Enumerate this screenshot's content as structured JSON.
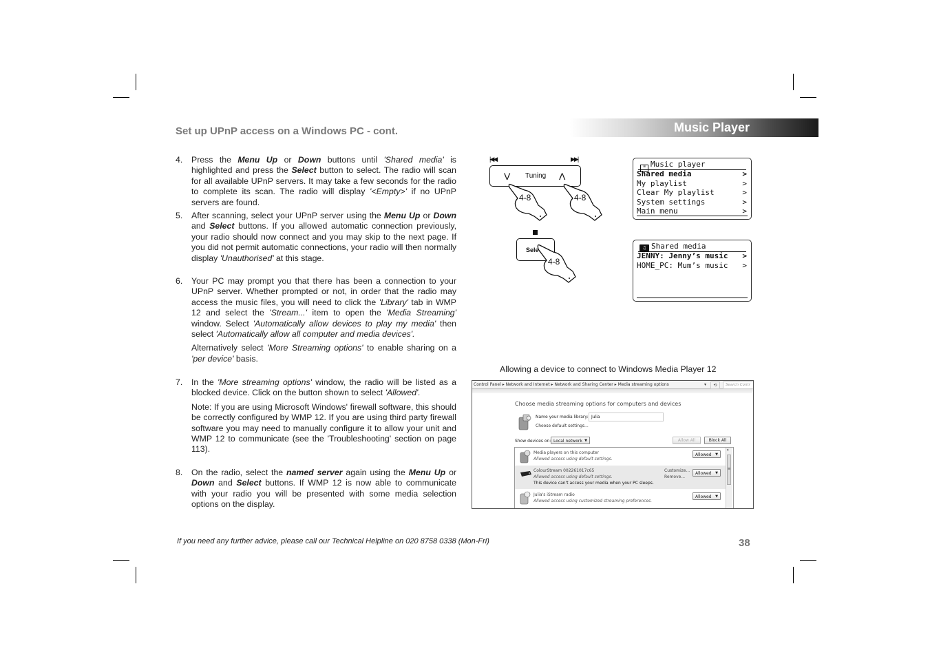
{
  "page": {
    "section_title": "Set up UPnP access on a Windows PC - cont.",
    "header_banner": "Music Player",
    "page_number": "38",
    "footer_note": "If you need any further advice, please call our Technical Helpline on 020 8758 0338 (Mon-Fri)",
    "colors": {
      "section_title": "#7a7a7a",
      "banner_text": "#ffffff",
      "banner_dark": "#1a1a1a",
      "page_number": "#777777"
    }
  },
  "steps": [
    {
      "number": "4.",
      "paragraphs": [
        [
          {
            "t": "Press the ",
            "s": ""
          },
          {
            "t": "Menu Up",
            "s": "bi"
          },
          {
            "t": " or ",
            "s": ""
          },
          {
            "t": "Down",
            "s": "bi"
          },
          {
            "t": " buttons until ",
            "s": ""
          },
          {
            "t": "'Shared media'",
            "s": "i"
          },
          {
            "t": " is highlighted and press the ",
            "s": ""
          },
          {
            "t": "Select",
            "s": "bi"
          },
          {
            "t": " button to select. The radio will scan for all available UPnP servers. It may take a few seconds for the radio to complete its scan. The radio will display ",
            "s": ""
          },
          {
            "t": "'<Empty>'",
            "s": "i"
          },
          {
            "t": " if no UPnP servers are found.",
            "s": ""
          }
        ]
      ]
    },
    {
      "number": "5.",
      "paragraphs": [
        [
          {
            "t": "After scanning, select your UPnP server using the ",
            "s": ""
          },
          {
            "t": "Menu Up",
            "s": "bi"
          },
          {
            "t": " or ",
            "s": ""
          },
          {
            "t": "Down",
            "s": "bi"
          },
          {
            "t": " and ",
            "s": ""
          },
          {
            "t": "Select",
            "s": "bi"
          },
          {
            "t": " buttons. If you allowed automatic connection previously, your radio should now connect and you may skip to the next page. If you did not permit automatic connections, your radio will then normally display ",
            "s": ""
          },
          {
            "t": "'Unauthorised'",
            "s": "i"
          },
          {
            "t": " at this stage.",
            "s": ""
          }
        ]
      ]
    },
    {
      "number": "6.",
      "paragraphs": [
        [
          {
            "t": "Your PC may prompt you that there has been a connection to your UPnP server. Whether prompted or not, in order that the radio may access the music files, you will need to click the ",
            "s": ""
          },
          {
            "t": "'Library'",
            "s": "i"
          },
          {
            "t": " tab in WMP 12 and select the ",
            "s": ""
          },
          {
            "t": "'Stream...'",
            "s": "i"
          },
          {
            "t": " item to open the ",
            "s": ""
          },
          {
            "t": "'Media Streaming'",
            "s": "i"
          },
          {
            "t": " window. Select ",
            "s": ""
          },
          {
            "t": "'Automatically allow devices  to play my media'",
            "s": "i"
          },
          {
            "t": " then select ",
            "s": ""
          },
          {
            "t": "'Automatically allow all computer and media devices'.",
            "s": "i"
          }
        ],
        [
          {
            "t": "Alternatively select ",
            "s": ""
          },
          {
            "t": "'More Streaming options'",
            "s": "i"
          },
          {
            "t": " to enable sharing on a ",
            "s": ""
          },
          {
            "t": "'per device'",
            "s": "i"
          },
          {
            "t": " basis.",
            "s": ""
          }
        ]
      ]
    },
    {
      "number": "7.",
      "paragraphs": [
        [
          {
            "t": "In the ",
            "s": ""
          },
          {
            "t": "'More streaming options'",
            "s": "i"
          },
          {
            "t": " window, the radio will be listed as a blocked device. Click on the button shown to select ",
            "s": ""
          },
          {
            "t": "'Allowed'.",
            "s": "i"
          }
        ],
        [
          {
            "t": "Note: If you are using Microsoft Windows' firewall software, this should be correctly configured by WMP 12. If you are using third party firewall software you may need to manually configure it to allow your unit and WMP 12 to communicate (see the 'Troubleshooting' section on page 113).",
            "s": ""
          }
        ]
      ]
    },
    {
      "number": "8.",
      "paragraphs": [
        [
          {
            "t": "On the radio, select the ",
            "s": ""
          },
          {
            "t": "named server",
            "s": "bi"
          },
          {
            "t": " again using the ",
            "s": ""
          },
          {
            "t": "Menu Up",
            "s": "bi"
          },
          {
            "t": " or ",
            "s": ""
          },
          {
            "t": "Down",
            "s": "bi"
          },
          {
            "t": " and ",
            "s": ""
          },
          {
            "t": "Select",
            "s": "bi"
          },
          {
            "t": " buttons. If WMP 12 is now able to communicate with your radio you will be presented with some media selection options on the display.",
            "s": ""
          }
        ]
      ]
    }
  ],
  "controls": {
    "skip_back_icon": "skip-previous-icon",
    "skip_forward_icon": "skip-next-icon",
    "down_glyph": "V",
    "up_glyph": "Λ",
    "tuning_label": "Tuning",
    "stop_icon": "stop-icon",
    "select_label": "Select",
    "step_ref": "4-8"
  },
  "lcd_music_player": {
    "icon": "menu-list-icon",
    "title": "Music player",
    "rows": [
      {
        "label": "Shared media",
        "arrow": ">",
        "selected": true
      },
      {
        "label": "My playlist",
        "arrow": ">",
        "selected": false
      },
      {
        "label": "Clear My playlist",
        "arrow": ">",
        "selected": false
      },
      {
        "label": "System settings",
        "arrow": ">",
        "selected": false
      },
      {
        "label": "Main menu",
        "arrow": ">",
        "selected": false
      }
    ]
  },
  "lcd_shared_media": {
    "icon": "shared-folder-music-icon",
    "title": "Shared media",
    "rows": [
      {
        "label": "JENNY: Jenny’s music",
        "arrow": ">",
        "selected": true
      },
      {
        "label": "HOME_PC: Mum’s music",
        "arrow": ">",
        "selected": false
      }
    ]
  },
  "figure_caption": "Allowing a device to connect to Windows Media Player 12",
  "windows_dialog": {
    "breadcrumb": [
      "Control Panel",
      "Network and Internet",
      "Network and Sharing Center",
      "Media streaming options"
    ],
    "search_placeholder": "Search Contr",
    "heading": "Choose media streaming options for computers and devices",
    "library_name_label": "Name your media library:",
    "library_name_value": "Julia",
    "default_settings_link": "Choose default settings...",
    "show_devices_label": "Show devices on:",
    "show_devices_value": "Local network",
    "allow_all": "Allow All",
    "block_all": "Block All",
    "devices": [
      {
        "name": "Media players on this computer",
        "status": "Allowed access using default settings.",
        "warning": "",
        "links": [],
        "access": "Allowed"
      },
      {
        "name": "ColourStream 002261017c65",
        "status": "Allowed access using default settings.",
        "warning": "This device can't access your media when your PC sleeps.",
        "links": [
          "Customize...",
          "Remove..."
        ],
        "access": "Allowed"
      },
      {
        "name": "Julia's iStream radio",
        "status": "Allowed access using customized streaming preferences.",
        "warning": "",
        "links": [],
        "access": "Allowed"
      }
    ]
  }
}
